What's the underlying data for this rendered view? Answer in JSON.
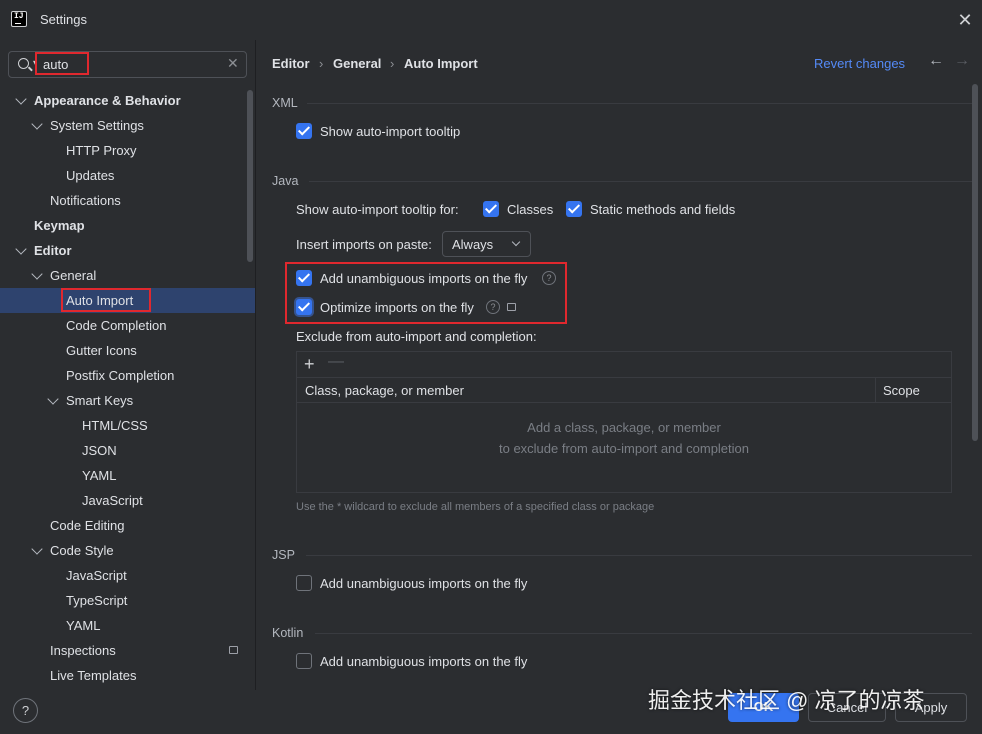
{
  "window": {
    "title": "Settings"
  },
  "search": {
    "value": "auto"
  },
  "tree": [
    {
      "label": "Appearance & Behavior"
    },
    {
      "label": "System Settings"
    },
    {
      "label": "HTTP Proxy"
    },
    {
      "label": "Updates"
    },
    {
      "label": "Notifications"
    },
    {
      "label": "Keymap"
    },
    {
      "label": "Editor"
    },
    {
      "label": "General"
    },
    {
      "label": "Auto Import"
    },
    {
      "label": "Code Completion"
    },
    {
      "label": "Gutter Icons"
    },
    {
      "label": "Postfix Completion"
    },
    {
      "label": "Smart Keys"
    },
    {
      "label": "HTML/CSS"
    },
    {
      "label": "JSON"
    },
    {
      "label": "YAML"
    },
    {
      "label": "JavaScript"
    },
    {
      "label": "Code Editing"
    },
    {
      "label": "Code Style"
    },
    {
      "label": "JavaScript"
    },
    {
      "label": "TypeScript"
    },
    {
      "label": "YAML"
    },
    {
      "label": "Inspections"
    },
    {
      "label": "Live Templates"
    }
  ],
  "breadcrumb": [
    "Editor",
    "General",
    "Auto Import"
  ],
  "revert_label": "Revert changes",
  "xml": {
    "section": "XML",
    "show_tooltip": {
      "label": "Show auto-import tooltip",
      "checked": true
    }
  },
  "java": {
    "section": "Java",
    "tooltip_for_label": "Show auto-import tooltip for:",
    "classes": {
      "label": "Classes",
      "checked": true
    },
    "static_methods": {
      "label": "Static methods and fields",
      "checked": true
    },
    "insert_label": "Insert imports on paste:",
    "insert_value": "Always",
    "add_unambiguous": {
      "label": "Add unambiguous imports on the fly",
      "checked": true
    },
    "optimize": {
      "label": "Optimize imports on the fly",
      "checked": true
    },
    "exclude_label": "Exclude from auto-import and completion:",
    "table": {
      "columns": [
        "Class, package, or member",
        "Scope"
      ],
      "empty_line1": "Add a class, package, or member",
      "empty_line2": "to exclude from auto-import and completion"
    },
    "hint": "Use the * wildcard to exclude all members of a specified class or package"
  },
  "jsp": {
    "section": "JSP",
    "add_unambiguous": {
      "label": "Add unambiguous imports on the fly",
      "checked": false
    }
  },
  "kotlin": {
    "section": "Kotlin",
    "add_unambiguous": {
      "label": "Add unambiguous imports on the fly",
      "checked": false
    }
  },
  "buttons": {
    "ok": "OK",
    "cancel": "Cancel",
    "apply": "Apply"
  },
  "watermark": "掘金技术社区 @ 凉了的凉茶",
  "colors": {
    "accent": "#3574f0",
    "highlight_box": "#e0282e",
    "selection": "#2e436e",
    "link": "#548af7"
  }
}
